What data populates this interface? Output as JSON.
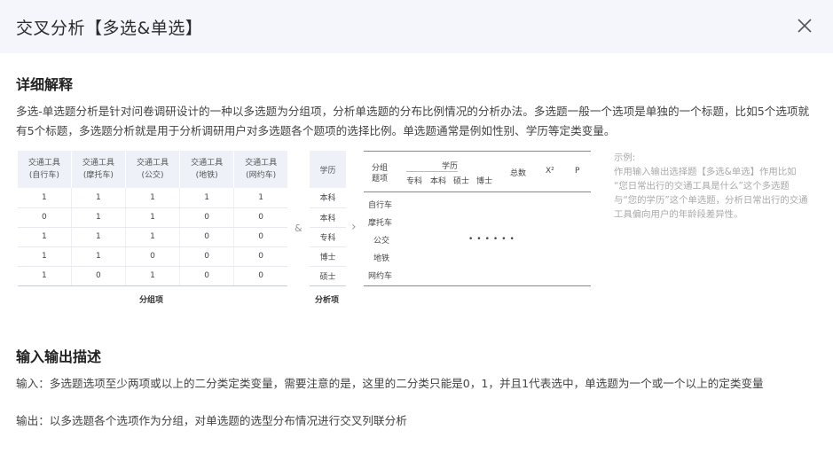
{
  "dialog": {
    "title": "交叉分析【多选&单选】",
    "close_icon": "close-icon"
  },
  "detail": {
    "heading": "详细解释",
    "description": "多选-单选题分析是针对问卷调研设计的一种以多选题为分组项，分析单选题的分布比例情况的分析办法。多选题一般一个选项是单独的一个标题，比如5个选项就有5个标题，多选题分析就是用于分析调研用户对多选题各个题项的选择比例。单选题通常是例如性别、学历等定类变量。"
  },
  "group_table": {
    "headers": [
      [
        "交通工具",
        "(自行车)"
      ],
      [
        "交通工具",
        "(摩托车)"
      ],
      [
        "交通工具",
        "(公交)"
      ],
      [
        "交通工具",
        "(地铁)"
      ],
      [
        "交通工具",
        "(网约车)"
      ]
    ],
    "rows": [
      [
        "1",
        "1",
        "1",
        "1",
        "1"
      ],
      [
        "0",
        "1",
        "1",
        "0",
        "0"
      ],
      [
        "1",
        "1",
        "1",
        "0",
        "0"
      ],
      [
        "1",
        "1",
        "0",
        "0",
        "0"
      ],
      [
        "1",
        "0",
        "1",
        "0",
        "0"
      ]
    ],
    "caption": "分组项"
  },
  "symbols": {
    "and": "&",
    "arrow": "›"
  },
  "analysis_table": {
    "header": "学历",
    "rows": [
      "本科",
      "本科",
      "专科",
      "博士",
      "硕士"
    ],
    "caption": "分析项"
  },
  "result_table": {
    "group_header": [
      "分组",
      "题项"
    ],
    "edu_header": "学历",
    "edu_sub": [
      "专科",
      "本科",
      "硕士",
      "博士"
    ],
    "total": "总数",
    "chi": "X²",
    "p": "P",
    "rows": [
      "自行车",
      "摩托车",
      "公交",
      "地铁",
      "网约车"
    ],
    "dots": "••••••"
  },
  "example": {
    "label": "示例:",
    "text": "作用输入输出选择题【多选&单选】作用比如 “您日常出行的交通工具是什么”这个多选题与“您的学历”这个单选题，分析日常出行的交通工具偏向用户的年龄段差异性。"
  },
  "io": {
    "heading": "输入输出描述",
    "input": "输入：多选题选项至少两项或以上的二分类定类变量，需要注意的是，这里的二分类只能是0，1，并且1代表选中，单选题为一个或一个以上的定类变量",
    "output": "输出：以多选题各个选项作为分组，对单选题的选型分布情况进行交叉列联分析"
  }
}
